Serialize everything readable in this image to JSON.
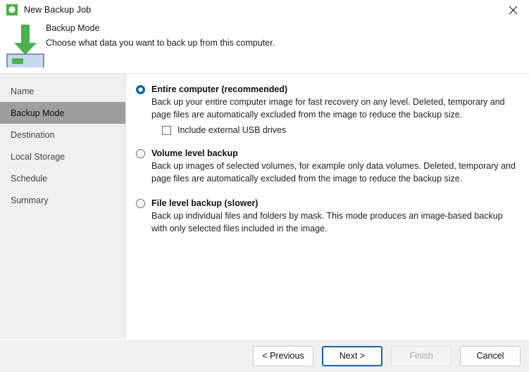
{
  "window": {
    "title": "New Backup Job",
    "title_icon": "gear-icon",
    "close_icon": "close-icon"
  },
  "header": {
    "icon": "download-to-drive-icon",
    "title": "Backup Mode",
    "subtitle": "Choose what data you want to back up from this computer."
  },
  "sidebar": {
    "items": [
      {
        "label": "Name",
        "selected": false
      },
      {
        "label": "Backup Mode",
        "selected": true
      },
      {
        "label": "Destination",
        "selected": false
      },
      {
        "label": "Local Storage",
        "selected": false
      },
      {
        "label": "Schedule",
        "selected": false
      },
      {
        "label": "Summary",
        "selected": false
      }
    ]
  },
  "main": {
    "options": [
      {
        "id": "entire-computer",
        "label": "Entire computer (recommended)",
        "description": "Back up your entire computer image for fast recovery on any level. Deleted, temporary and page files are automatically excluded from the image to reduce the backup size.",
        "selected": true,
        "checkbox": {
          "label": "Include external USB drives",
          "checked": false
        }
      },
      {
        "id": "volume-level-backup",
        "label": "Volume level backup",
        "description": "Back up images of selected volumes, for example only data volumes. Deleted, temporary and page files are automatically excluded from the image to reduce the backup size.",
        "selected": false
      },
      {
        "id": "file-level-backup",
        "label": "File level backup (slower)",
        "description": "Back up individual files and folders by mask. This mode produces an image-based backup with only selected files included in the image.",
        "selected": false
      }
    ]
  },
  "footer": {
    "previous_label": "< Previous",
    "next_label": "Next >",
    "finish_label": "Finish",
    "cancel_label": "Cancel",
    "finish_disabled": true,
    "next_is_default": true
  },
  "colors": {
    "accent_blue": "#0a64ad",
    "focus_blue": "#1565a8",
    "brand_green": "#4caf3f",
    "sidebar_bg": "#f0f0f0",
    "selected_item_bg": "#9e9e9e"
  }
}
